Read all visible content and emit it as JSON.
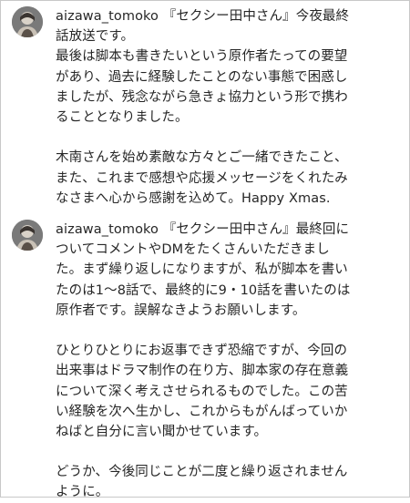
{
  "posts": [
    {
      "username": "aizawa_tomoko",
      "caption_head": " 『セクシー田中さん』今夜最終",
      "lines": [
        "話放送です。",
        "最後は脚本も書きたいという原作者たっての要望",
        "があり、過去に経験したことのない事態で困惑し",
        "ましたが、残念ながら急きょ協力という形で携わ",
        "ることとなりました。",
        "",
        "木南さんを始め素敵な方々とご一緒できたこと、",
        "また、これまで感想や応援メッセージをくれたみ",
        "なさまへ心から感謝を込めて。Happy Xmas."
      ]
    },
    {
      "username": "aizawa_tomoko",
      "caption_head": " 『セクシー田中さん』最終回に",
      "lines": [
        "ついてコメントやDMをたくさんいただきまし",
        "た。まず繰り返しになりますが、私が脚本を書い",
        "たのは1〜8話で、最終的に9・10話を書いたのは",
        "原作者です。誤解なきようお願いします。",
        "",
        "ひとりひとりにお返事できず恐縮ですが、今回の",
        "出来事はドラマ制作の在り方、脚本家の存在意義",
        "について深く考えさせられるものでした。この苦",
        "い経験を次へ生かし、これからもがんばっていか",
        "ねばと自分に言い聞かせています。",
        "",
        "どうか、今後同じことが二度と繰り返されません",
        "ように。"
      ]
    }
  ]
}
